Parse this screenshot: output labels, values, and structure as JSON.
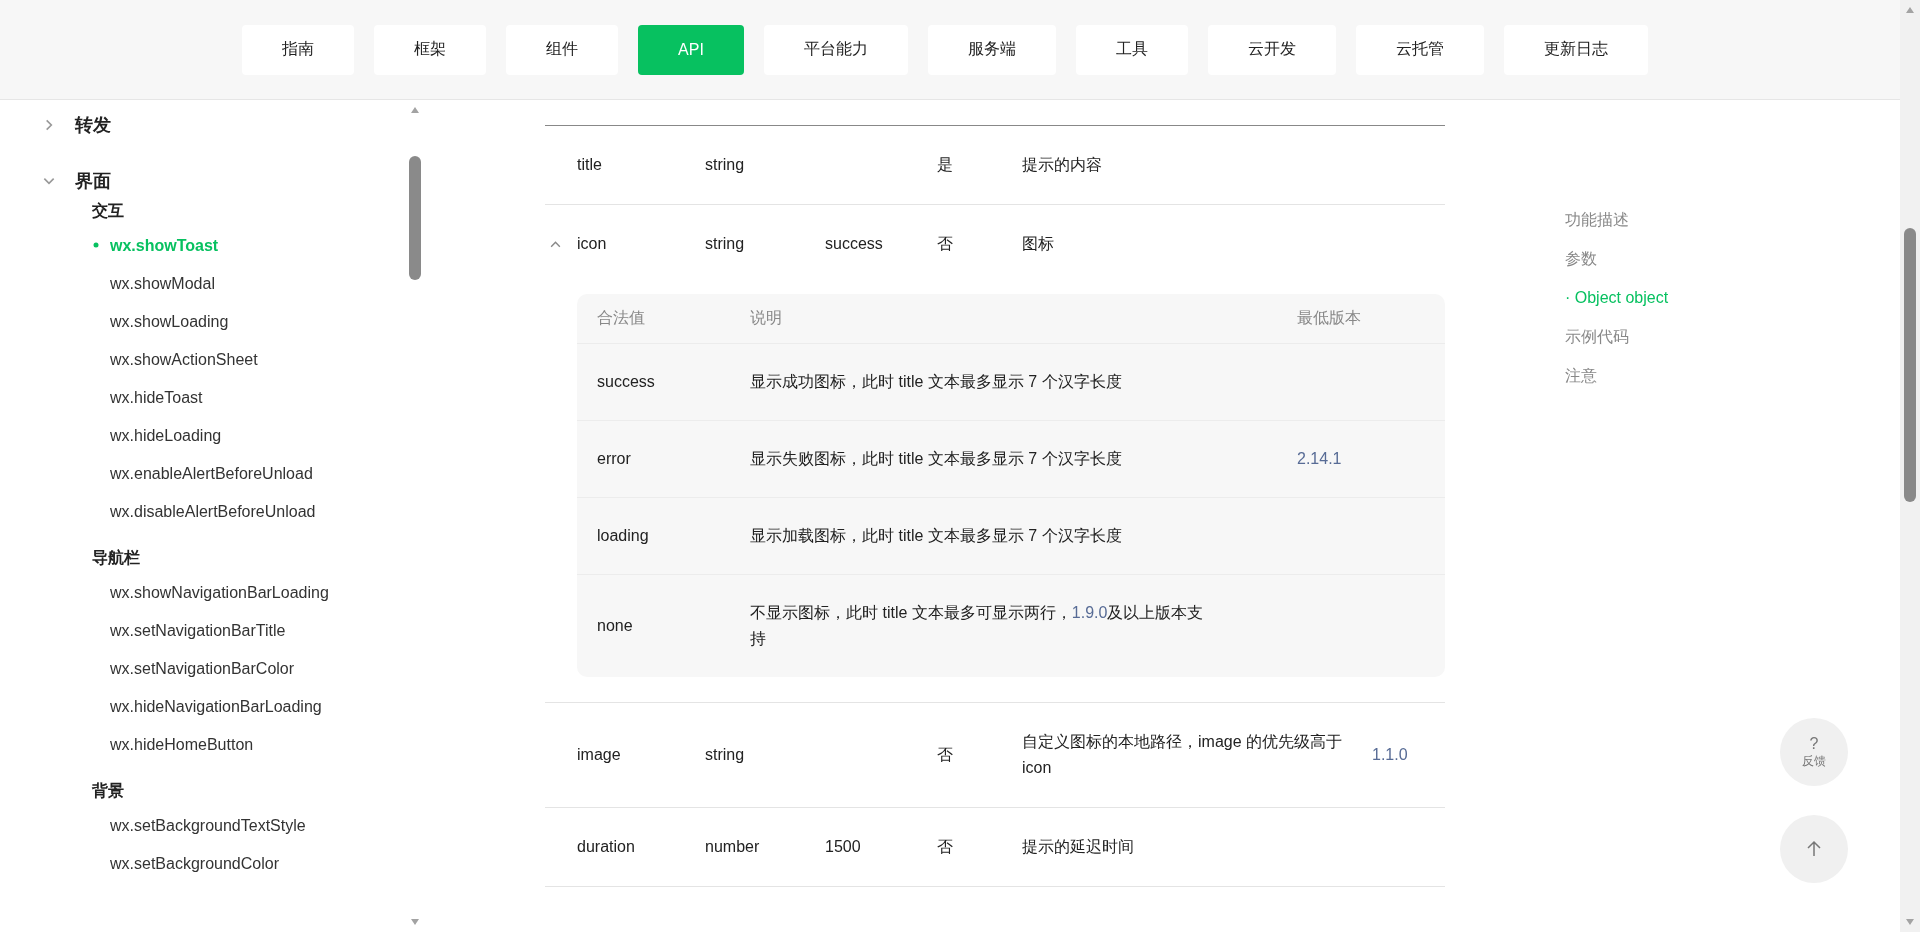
{
  "nav": {
    "tabs": [
      {
        "label": "指南",
        "selected": false
      },
      {
        "label": "框架",
        "selected": false
      },
      {
        "label": "组件",
        "selected": false
      },
      {
        "label": "API",
        "selected": true
      },
      {
        "label": "平台能力",
        "selected": false
      },
      {
        "label": "服务端",
        "selected": false
      },
      {
        "label": "工具",
        "selected": false
      },
      {
        "label": "云开发",
        "selected": false
      },
      {
        "label": "云托管",
        "selected": false
      },
      {
        "label": "更新日志",
        "selected": false
      }
    ]
  },
  "sidebar": {
    "items": [
      {
        "label": "转发",
        "expanded": false
      },
      {
        "label": "界面",
        "expanded": true,
        "children": [
          {
            "label": "交互",
            "children": [
              {
                "label": "wx.showToast",
                "selected": true
              },
              {
                "label": "wx.showModal",
                "selected": false
              },
              {
                "label": "wx.showLoading",
                "selected": false
              },
              {
                "label": "wx.showActionSheet",
                "selected": false
              },
              {
                "label": "wx.hideToast",
                "selected": false
              },
              {
                "label": "wx.hideLoading",
                "selected": false
              },
              {
                "label": "wx.enableAlertBeforeUnload",
                "selected": false
              },
              {
                "label": "wx.disableAlertBeforeUnload",
                "selected": false
              }
            ]
          },
          {
            "label": "导航栏",
            "children": [
              {
                "label": "wx.showNavigationBarLoading",
                "selected": false
              },
              {
                "label": "wx.setNavigationBarTitle",
                "selected": false
              },
              {
                "label": "wx.setNavigationBarColor",
                "selected": false
              },
              {
                "label": "wx.hideNavigationBarLoading",
                "selected": false
              },
              {
                "label": "wx.hideHomeButton",
                "selected": false
              }
            ]
          },
          {
            "label": "背景",
            "children": [
              {
                "label": "wx.setBackgroundTextStyle",
                "selected": false
              },
              {
                "label": "wx.setBackgroundColor",
                "selected": false
              }
            ]
          }
        ]
      }
    ]
  },
  "table": {
    "rows": [
      {
        "name": "title",
        "type": "string",
        "required": "是",
        "description": "提示的内容"
      },
      {
        "name": "icon",
        "type": "string",
        "default": "success",
        "required": "否",
        "description": "图标",
        "expanded": true,
        "options": {
          "columns": [
            "合法值",
            "说明",
            "最低版本"
          ],
          "rows": [
            {
              "value": "success",
              "description": [
                {
                  "kind": "text",
                  "text": "显示成功图标，此时 title 文本最多显示 7 个汉字长度"
                }
              ]
            },
            {
              "value": "error",
              "description": [
                {
                  "kind": "text",
                  "text": "显示失败图标，此时 title 文本最多显示 7 个汉字长度"
                }
              ],
              "version": "2.14.1"
            },
            {
              "value": "loading",
              "description": [
                {
                  "kind": "text",
                  "text": "显示加载图标，此时 title 文本最多显示 7 个汉字长度"
                }
              ]
            },
            {
              "value": "none",
              "description": [
                {
                  "kind": "text",
                  "text": "不显示图标，此时 title 文本最多可显示两行，"
                },
                {
                  "kind": "link",
                  "text": "1.9.0"
                },
                {
                  "kind": "text",
                  "text": "及以上版本支持"
                }
              ]
            }
          ]
        }
      },
      {
        "name": "image",
        "type": "string",
        "required": "否",
        "description": "自定义图标的本地路径，image 的优先级高于 icon",
        "version": "1.1.0"
      },
      {
        "name": "duration",
        "type": "number",
        "default": "1500",
        "required": "否",
        "description": "提示的延迟时间"
      }
    ]
  },
  "toc": {
    "items": [
      {
        "label": "功能描述",
        "selected": false
      },
      {
        "label": "参数",
        "selected": false
      },
      {
        "label": "· Object object",
        "selected": true
      },
      {
        "label": "示例代码",
        "selected": false
      },
      {
        "label": "注意",
        "selected": false
      }
    ]
  },
  "feedback": {
    "icon": "?",
    "label": "反馈"
  }
}
